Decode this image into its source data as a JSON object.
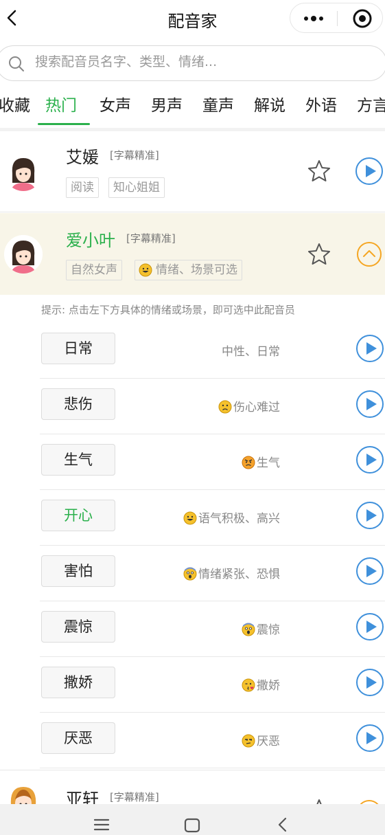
{
  "header": {
    "title": "配音家",
    "back_icon": "chevron-left-icon",
    "more_icon": "more-dots-icon",
    "close_icon": "target-close-icon"
  },
  "search": {
    "placeholder": "搜索配音员名字、类型、情绪..."
  },
  "tabs": [
    {
      "label": "收藏",
      "active": false
    },
    {
      "label": "热门",
      "active": true
    },
    {
      "label": "女声",
      "active": false
    },
    {
      "label": "男声",
      "active": false
    },
    {
      "label": "童声",
      "active": false
    },
    {
      "label": "解说",
      "active": false
    },
    {
      "label": "外语",
      "active": false
    },
    {
      "label": "方言",
      "active": false
    }
  ],
  "accent_color": "#2bb04c",
  "voices": [
    {
      "name": "艾媛",
      "badge": "[字幕精准]",
      "tags": [
        "阅读",
        "知心姐姐"
      ],
      "expanded": false
    },
    {
      "name": "爱小叶",
      "badge": "[字幕精准]",
      "tags": [
        "自然女声",
        "情绪、场景可选"
      ],
      "expanded": true
    },
    {
      "name": "亚轩",
      "badge": "[字幕精准]",
      "tags": [],
      "expanded": false
    }
  ],
  "hint": "提示: 点击左下方具体的情绪或场景，即可选中此配音员",
  "emotions": [
    {
      "label": "日常",
      "desc": "中性、日常",
      "emoji": "",
      "active": false
    },
    {
      "label": "悲伤",
      "desc": "伤心难过",
      "emoji": "sad-face",
      "active": false
    },
    {
      "label": "生气",
      "desc": "生气",
      "emoji": "angry-face",
      "active": false
    },
    {
      "label": "开心",
      "desc": "语气积极、高兴",
      "emoji": "grin-face",
      "active": true
    },
    {
      "label": "害怕",
      "desc": "情绪紧张、恐惧",
      "emoji": "scream-face",
      "active": false
    },
    {
      "label": "震惊",
      "desc": "震惊",
      "emoji": "scream-face",
      "active": false
    },
    {
      "label": "撒娇",
      "desc": "撒娇",
      "emoji": "kiss-face",
      "active": false
    },
    {
      "label": "厌恶",
      "desc": "厌恶",
      "emoji": "unamused-face",
      "active": false
    }
  ]
}
